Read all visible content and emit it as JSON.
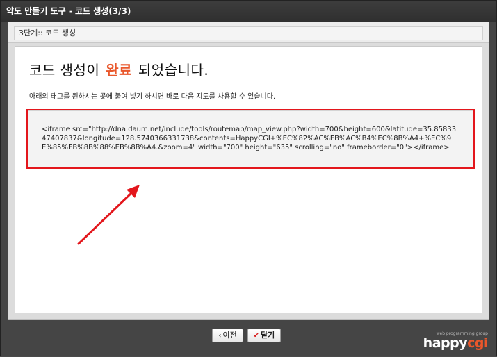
{
  "window": {
    "title": "약도 만들기 도구 - 코드 생성(3/3)"
  },
  "step": {
    "label": "3단계:: 코드 생성"
  },
  "main": {
    "headline_prefix": "코드 생성이",
    "headline_accent": "완료",
    "headline_suffix": "되었습니다.",
    "instruction": "아래의 태그를 원하시는 곳에 붙여 넣기 하시면 바로 다음 지도를 사용할 수 있습니다.",
    "code": "<iframe src=\"http://dna.daum.net/include/tools/routemap/map_view.php?width=700&height=600&latitude=35.8583347407837&longitude=128.5740366331738&contents=HappyCGI+%EC%82%AC%EB%AC%B4%EC%8B%A4+%EC%9E%85%EB%8B%88%EB%8B%A4.&zoom=4\" width=\"700\" height=\"635\" scrolling=\"no\" frameborder=\"0\"></iframe>"
  },
  "buttons": {
    "prev_label": "이전",
    "prev_icon": "chevron-left-icon",
    "close_label": "닫기",
    "close_icon": "check-icon"
  },
  "brand": {
    "tagline": "web programming group",
    "name_part1": "happy",
    "name_part2": "cgi"
  },
  "colors": {
    "accent": "#e9572b",
    "highlight_border": "#e3161c",
    "arrow": "#e3161c"
  }
}
